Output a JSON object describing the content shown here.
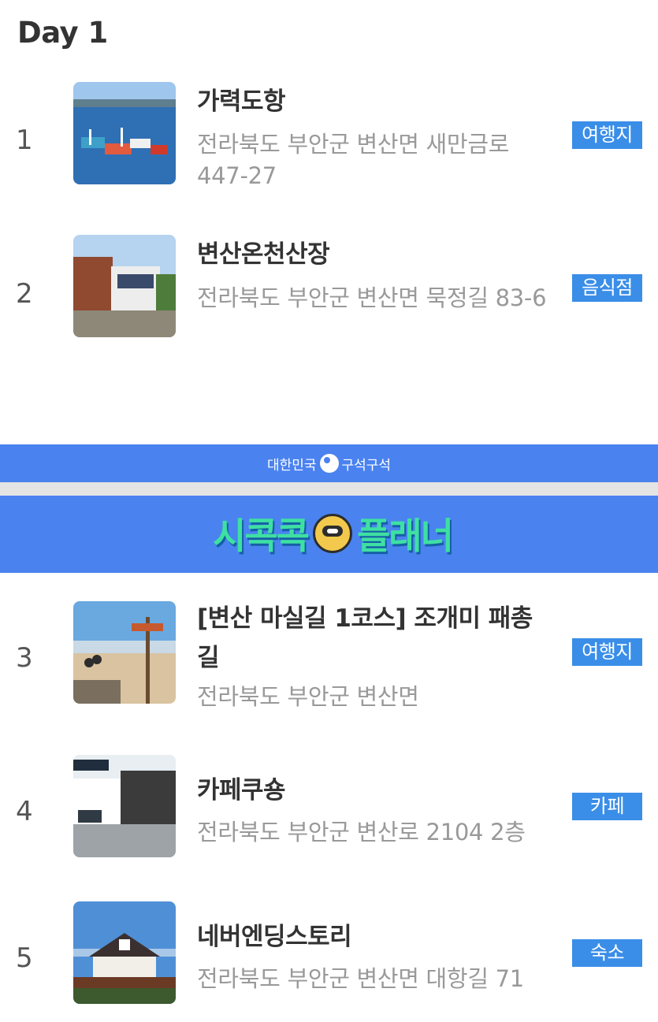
{
  "day_title": "Day 1",
  "items": [
    {
      "index": "1",
      "name": "가력도항",
      "address": "전라북도 부안군 변산면 새만금로 447-27",
      "category": "여행지"
    },
    {
      "index": "2",
      "name": "변산온천산장",
      "address": "전라북도 부안군 변산면 묵정길 83-6",
      "category": "음식점"
    },
    {
      "index": "3",
      "name": "[변산 마실길 1코스] 조개미 패총길",
      "address": "전라북도 부안군 변산면",
      "category": "여행지"
    },
    {
      "index": "4",
      "name": "카페쿠숑",
      "address": "전라북도 부안군 변산로 2104 2층",
      "category": "카페"
    },
    {
      "index": "5",
      "name": "네버엔딩스토리",
      "address": "전라북도 부안군 변산면 대항길 71",
      "category": "숙소"
    }
  ],
  "banner": {
    "top_left": "대한민국",
    "top_right": "구석구석",
    "logo_left": "시콕콕",
    "logo_right": "플래너"
  },
  "colors": {
    "badge": "#3a8ee8",
    "banner_blue": "#4a82ef",
    "logo_green": "#3ee0a2"
  }
}
